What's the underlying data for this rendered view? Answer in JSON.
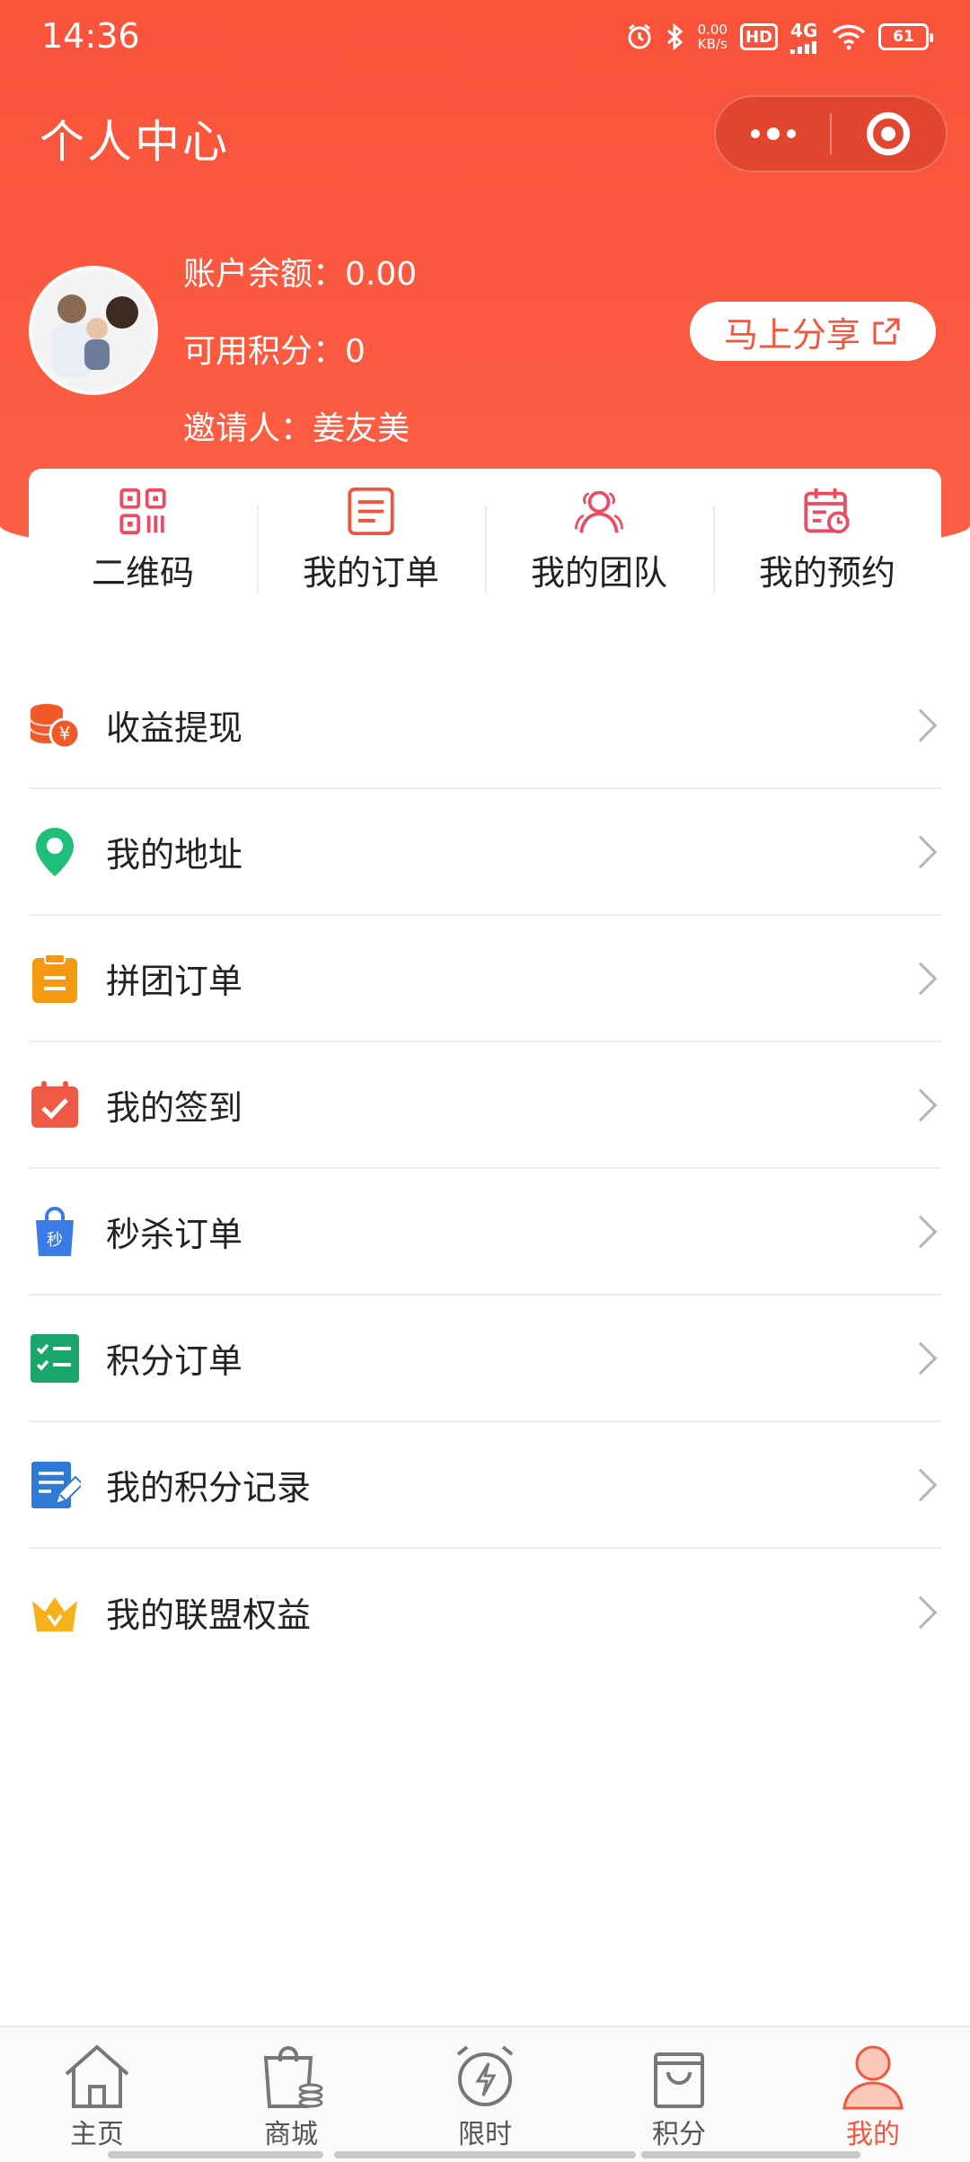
{
  "status_bar": {
    "time": "14:36",
    "net_speed_value": "0.00",
    "net_speed_unit": "KB/s",
    "hd_label": "HD",
    "network": "4G",
    "battery": "61",
    "icons": [
      "alarm-icon",
      "bluetooth-icon",
      "signal-icon",
      "wifi-icon",
      "battery-icon"
    ]
  },
  "header": {
    "title": "个人中心",
    "capsule": [
      "more-icon",
      "close-target-icon"
    ]
  },
  "profile": {
    "balance_label": "账户余额：",
    "balance_value": "0.00",
    "points_label": "可用积分：",
    "points_value": "0",
    "inviter_label": "邀请人：",
    "inviter_value": "姜友美",
    "share_button": "马上分享"
  },
  "quick_actions": [
    {
      "label": "二维码",
      "icon": "qrcode-icon"
    },
    {
      "label": "我的订单",
      "icon": "order-icon"
    },
    {
      "label": "我的团队",
      "icon": "team-icon"
    },
    {
      "label": "我的预约",
      "icon": "calendar-icon"
    }
  ],
  "menu": [
    {
      "label": "收益提现",
      "icon": "coins-icon"
    },
    {
      "label": "我的地址",
      "icon": "location-icon"
    },
    {
      "label": "拼团订单",
      "icon": "clipboard-icon"
    },
    {
      "label": "我的签到",
      "icon": "checkin-icon"
    },
    {
      "label": "秒杀订单",
      "icon": "flash-sale-bag-icon"
    },
    {
      "label": "积分订单",
      "icon": "checklist-icon"
    },
    {
      "label": "我的积分记录",
      "icon": "note-edit-icon"
    },
    {
      "label": "我的联盟权益",
      "icon": "crown-icon"
    }
  ],
  "menu_icon_text": {
    "coin": "¥",
    "bag": "秒"
  },
  "tabbar": [
    {
      "label": "主页",
      "icon": "home-icon",
      "active": false
    },
    {
      "label": "商城",
      "icon": "shop-bag-icon",
      "active": false
    },
    {
      "label": "限时",
      "icon": "alarm-clock-icon",
      "active": false
    },
    {
      "label": "积分",
      "icon": "points-bag-icon",
      "active": false
    },
    {
      "label": "我的",
      "icon": "user-icon",
      "active": true
    }
  ],
  "colors": {
    "primary": "#f9533a",
    "tab_active": "#f3563d",
    "location_green": "#1fbf7a",
    "clipboard_orange": "#f39a12",
    "checkin_red": "#f05a44",
    "bag_blue": "#3b7be8",
    "checklist_green": "#1aa56a",
    "note_blue": "#2f7ad6",
    "crown_gold": "#f7b21b"
  }
}
